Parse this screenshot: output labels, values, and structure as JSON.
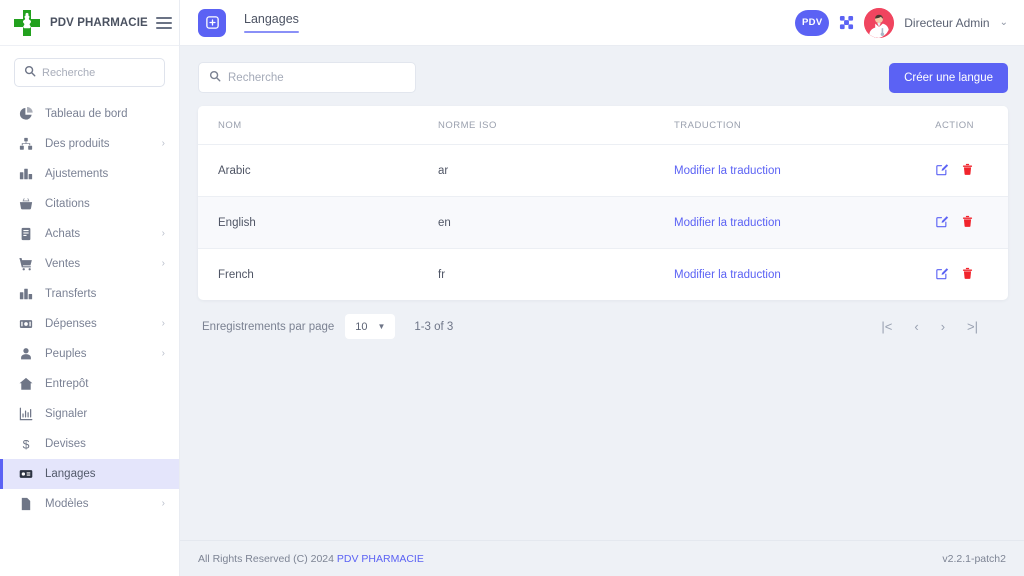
{
  "brand": {
    "name": "PDV PHARMACIE",
    "logo_icon": "pharmacy-cross-icon",
    "menu_icon": "hamburger-menu-icon"
  },
  "sidebar": {
    "search": {
      "placeholder": "Recherche",
      "icon": "search-icon"
    },
    "items": [
      {
        "label": "Tableau de bord",
        "icon": "dashboard-icon",
        "expandable": false,
        "active": false
      },
      {
        "label": "Des produits",
        "icon": "products-icon",
        "expandable": true,
        "active": false
      },
      {
        "label": "Ajustements",
        "icon": "adjustments-icon",
        "expandable": false,
        "active": false
      },
      {
        "label": "Citations",
        "icon": "quotes-basket-icon",
        "expandable": false,
        "active": false
      },
      {
        "label": "Achats",
        "icon": "purchases-icon",
        "expandable": true,
        "active": false
      },
      {
        "label": "Ventes",
        "icon": "sales-cart-icon",
        "expandable": true,
        "active": false
      },
      {
        "label": "Transferts",
        "icon": "transfers-icon",
        "expandable": false,
        "active": false
      },
      {
        "label": "Dépenses",
        "icon": "expenses-icon",
        "expandable": true,
        "active": false
      },
      {
        "label": "Peuples",
        "icon": "people-icon",
        "expandable": true,
        "active": false
      },
      {
        "label": "Entrepôt",
        "icon": "warehouse-home-icon",
        "expandable": false,
        "active": false
      },
      {
        "label": "Signaler",
        "icon": "report-chart-icon",
        "expandable": false,
        "active": false
      },
      {
        "label": "Devises",
        "icon": "currency-dollar-icon",
        "expandable": false,
        "active": false
      },
      {
        "label": "Langages",
        "icon": "languages-card-icon",
        "expandable": false,
        "active": true
      },
      {
        "label": "Modèles",
        "icon": "templates-file-icon",
        "expandable": true,
        "active": false
      }
    ]
  },
  "topbar": {
    "tile_icon": "plus-square-icon",
    "tab_label": "Langages",
    "pdv_badge": "PDV",
    "expand_icon": "fullscreen-icon",
    "avatar_icon": "doctor-avatar",
    "user_name": "Directeur Admin",
    "caret_icon": "chevron-down-icon"
  },
  "toolbar": {
    "search_placeholder": "Recherche",
    "search_icon": "search-icon",
    "create_label": "Créer une langue"
  },
  "table": {
    "columns": [
      "NOM",
      "NORME ISO",
      "TRADUCTION",
      "ACTION"
    ],
    "rows": [
      {
        "nom": "Arabic",
        "iso": "ar",
        "traduction": "Modifier la traduction",
        "edit_icon": "edit-pencil-icon",
        "delete_icon": "trash-icon"
      },
      {
        "nom": "English",
        "iso": "en",
        "traduction": "Modifier la traduction",
        "edit_icon": "edit-pencil-icon",
        "delete_icon": "trash-icon"
      },
      {
        "nom": "French",
        "iso": "fr",
        "traduction": "Modifier la traduction",
        "edit_icon": "edit-pencil-icon",
        "delete_icon": "trash-icon"
      }
    ]
  },
  "pagination": {
    "per_page_label": "Enregistrements par page",
    "per_page_value": "10",
    "range": "1-3 of 3",
    "first_icon": "|<",
    "prev_icon": "‹",
    "next_icon": "›",
    "last_icon": ">|"
  },
  "footer": {
    "copyright": "All Rights Reserved (C) 2024",
    "brand_link": "PDV PHARMACIE",
    "version": "v2.2.1-patch2"
  },
  "colors": {
    "accent": "#5b62f4",
    "brand_green": "#22a11e",
    "danger": "#f1242c",
    "avatar_bg": "#f0455f",
    "page_bg": "#eef1f6",
    "active_nav_bg": "#e4e5fb"
  }
}
